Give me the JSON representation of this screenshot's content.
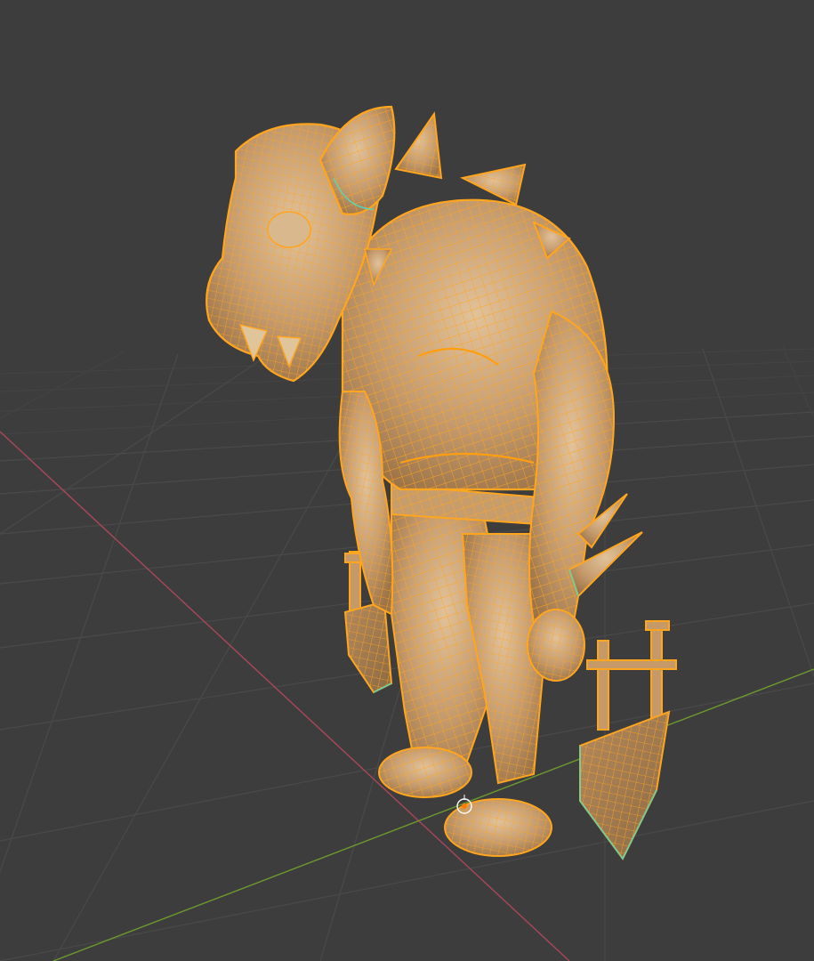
{
  "app": "3D viewport",
  "viewport": {
    "mode": "edit-mode-wireframe-overlay",
    "background_color": "#3d3d3d"
  },
  "grid": {
    "visible": true,
    "x_axis_color": "#a8485a",
    "y_axis_color": "#6d9a2c",
    "line_color": "#4a4a4a"
  },
  "object": {
    "kind": "character-mesh",
    "selected": true,
    "wire_color": "#ffa51e",
    "surface_color": "#c8a070",
    "seam_color": "#57d6b4"
  },
  "origin": {
    "icon": "object-origin-icon",
    "ring_color": "#ffffff",
    "center_color": "#ff7a00"
  }
}
